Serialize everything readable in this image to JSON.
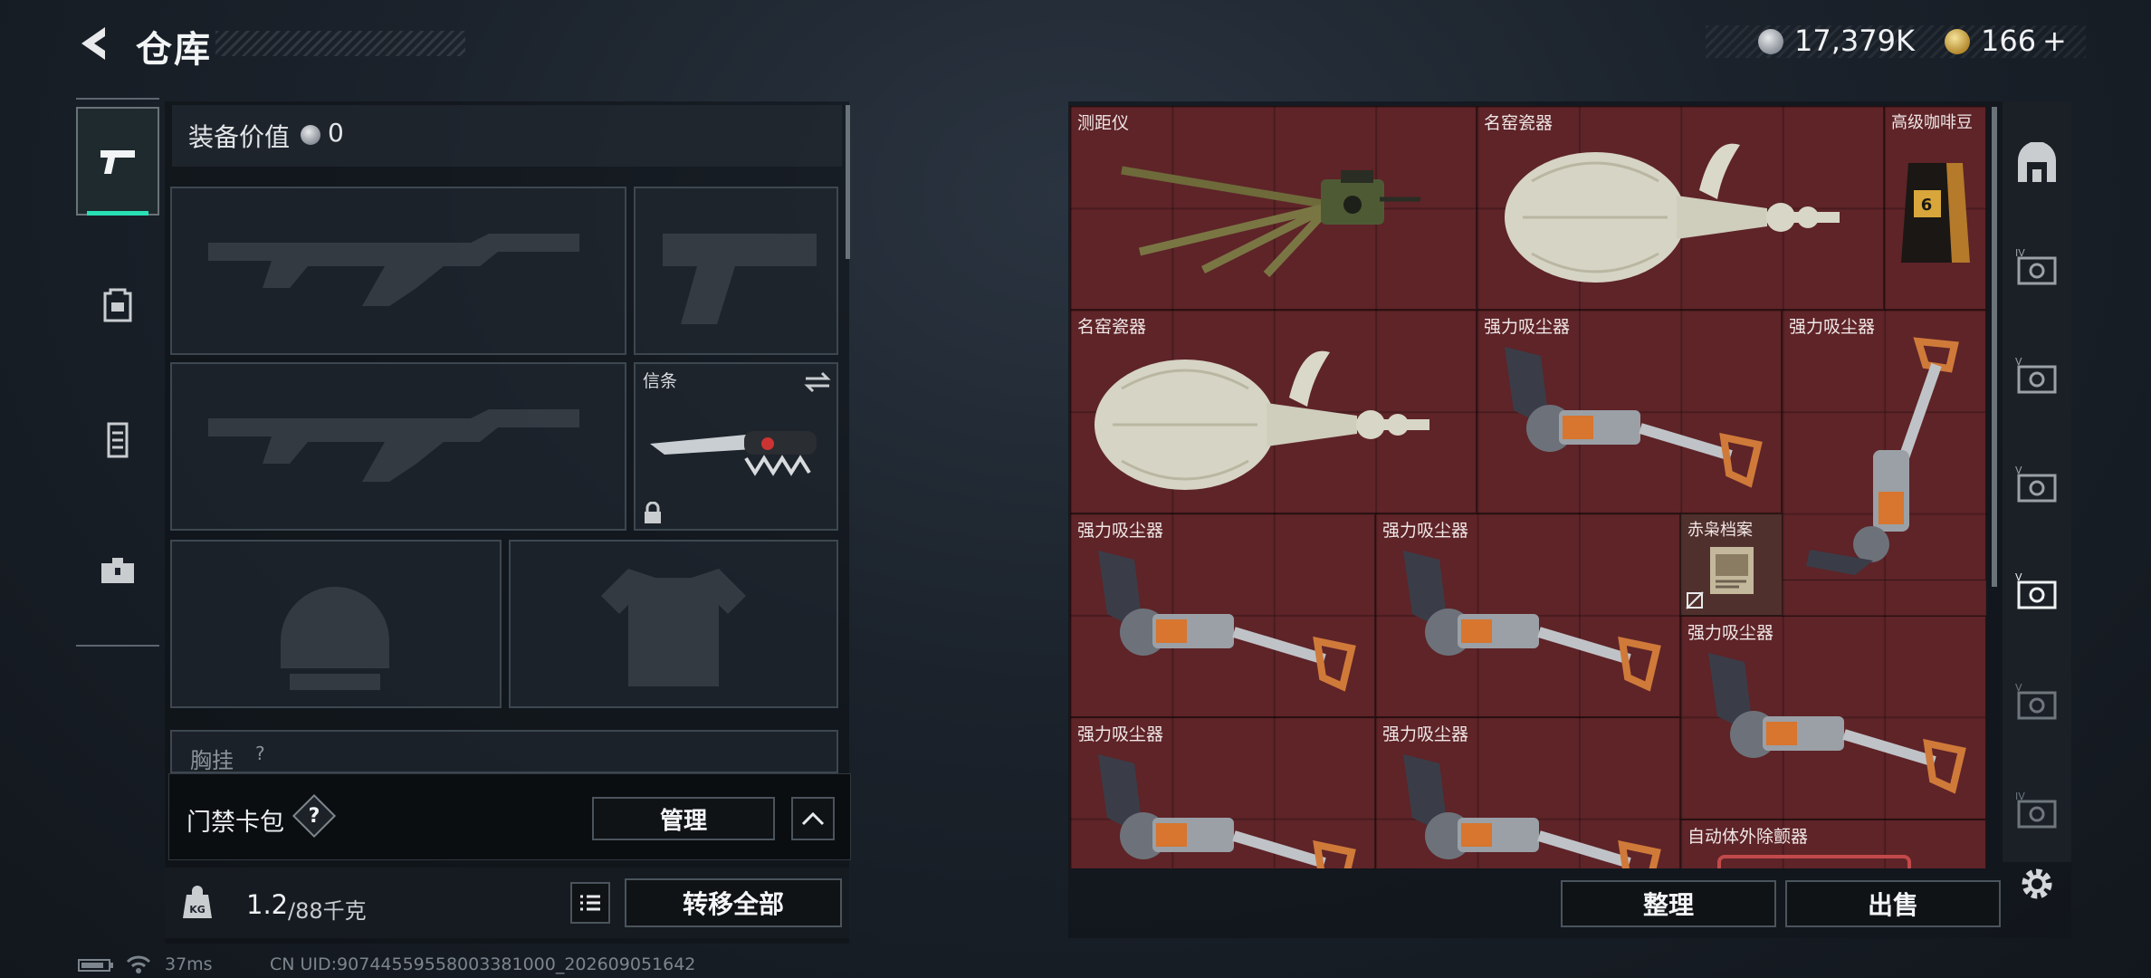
{
  "header": {
    "title": "仓库"
  },
  "currency": {
    "silver": "17,379K",
    "gold": "166",
    "gold_add": "+"
  },
  "equipment": {
    "value_label": "装备价值",
    "value": "0",
    "melee_slot_label": "信条",
    "chest_slot_label": "胸挂",
    "chest_slot_badge": "?"
  },
  "card_pack": {
    "label": "门禁卡包",
    "help": "?",
    "manage_button": "管理"
  },
  "capacity": {
    "current": "1.2",
    "max": "/88千克"
  },
  "transfer_all_button": "转移全部",
  "stash": {
    "items": [
      {
        "name": "测距仪",
        "icon": "rangefinder"
      },
      {
        "name": "名窑瓷器",
        "icon": "porcelain-vase"
      },
      {
        "name": "高级咖啡豆",
        "icon": "coffee-beans"
      },
      {
        "name": "名窑瓷器",
        "icon": "porcelain-vase"
      },
      {
        "name": "强力吸尘器",
        "icon": "vacuum-cleaner"
      },
      {
        "name": "强力吸尘器",
        "icon": "vacuum-cleaner"
      },
      {
        "name": "强力吸尘器",
        "icon": "vacuum-cleaner"
      },
      {
        "name": "强力吸尘器",
        "icon": "vacuum-cleaner"
      },
      {
        "name": "赤枭档案",
        "icon": "documents"
      },
      {
        "name": "强力吸尘器",
        "icon": "vacuum-cleaner"
      },
      {
        "name": "强力吸尘器",
        "icon": "vacuum-cleaner"
      },
      {
        "name": "强力吸尘器",
        "icon": "vacuum-cleaner"
      },
      {
        "name": "自动体外除颤器",
        "icon": "defibrillator"
      }
    ],
    "sort_button": "整理",
    "sell_button": "出售"
  },
  "status": {
    "ping": "37ms",
    "uid": "CN UID:9074455955800338100​0_202609051642"
  },
  "colors": {
    "accent": "#29e0b5",
    "grid_bg": "#5e2428"
  }
}
